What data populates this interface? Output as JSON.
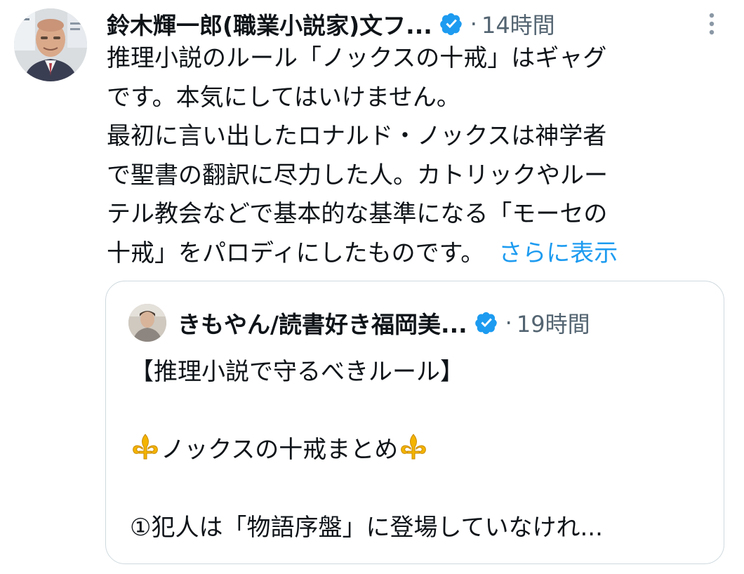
{
  "tweet": {
    "author_name": "鈴木輝一郎(職業小説家)文フ...",
    "separator": "·",
    "time": "14時間",
    "text_lines": [
      "推理小説のルール「ノックスの十戒」はギャグ",
      "です。本気にしてはいけません。",
      "最初に言い出したロナルド・ノックスは神学者",
      "で聖書の翻訳に尽力した人。カトリックやルー",
      "テル教会などで基本的な基準になる「モーセの",
      "十戒」をパロディにしたものです。"
    ],
    "show_more": "さらに表示"
  },
  "quote": {
    "author_name": "きもやん/読書好き福岡美...",
    "separator": "·",
    "time": "19時間",
    "line1": "【推理小説で守るべきルール】",
    "line2_text": "ノックスの十戒まとめ",
    "line3": "①犯人は「物語序盤」に登場していなけれ..."
  },
  "icons": {
    "verified": "verified-badge-icon",
    "more": "more-vertical-icon",
    "fleur": "fleur-de-lis-emoji"
  },
  "colors": {
    "text": "#0f1419",
    "secondary": "#536471",
    "link": "#1d9bf0",
    "verified": "#1d9bf0",
    "border": "#cfd9de",
    "fleur": "#f4b400"
  }
}
